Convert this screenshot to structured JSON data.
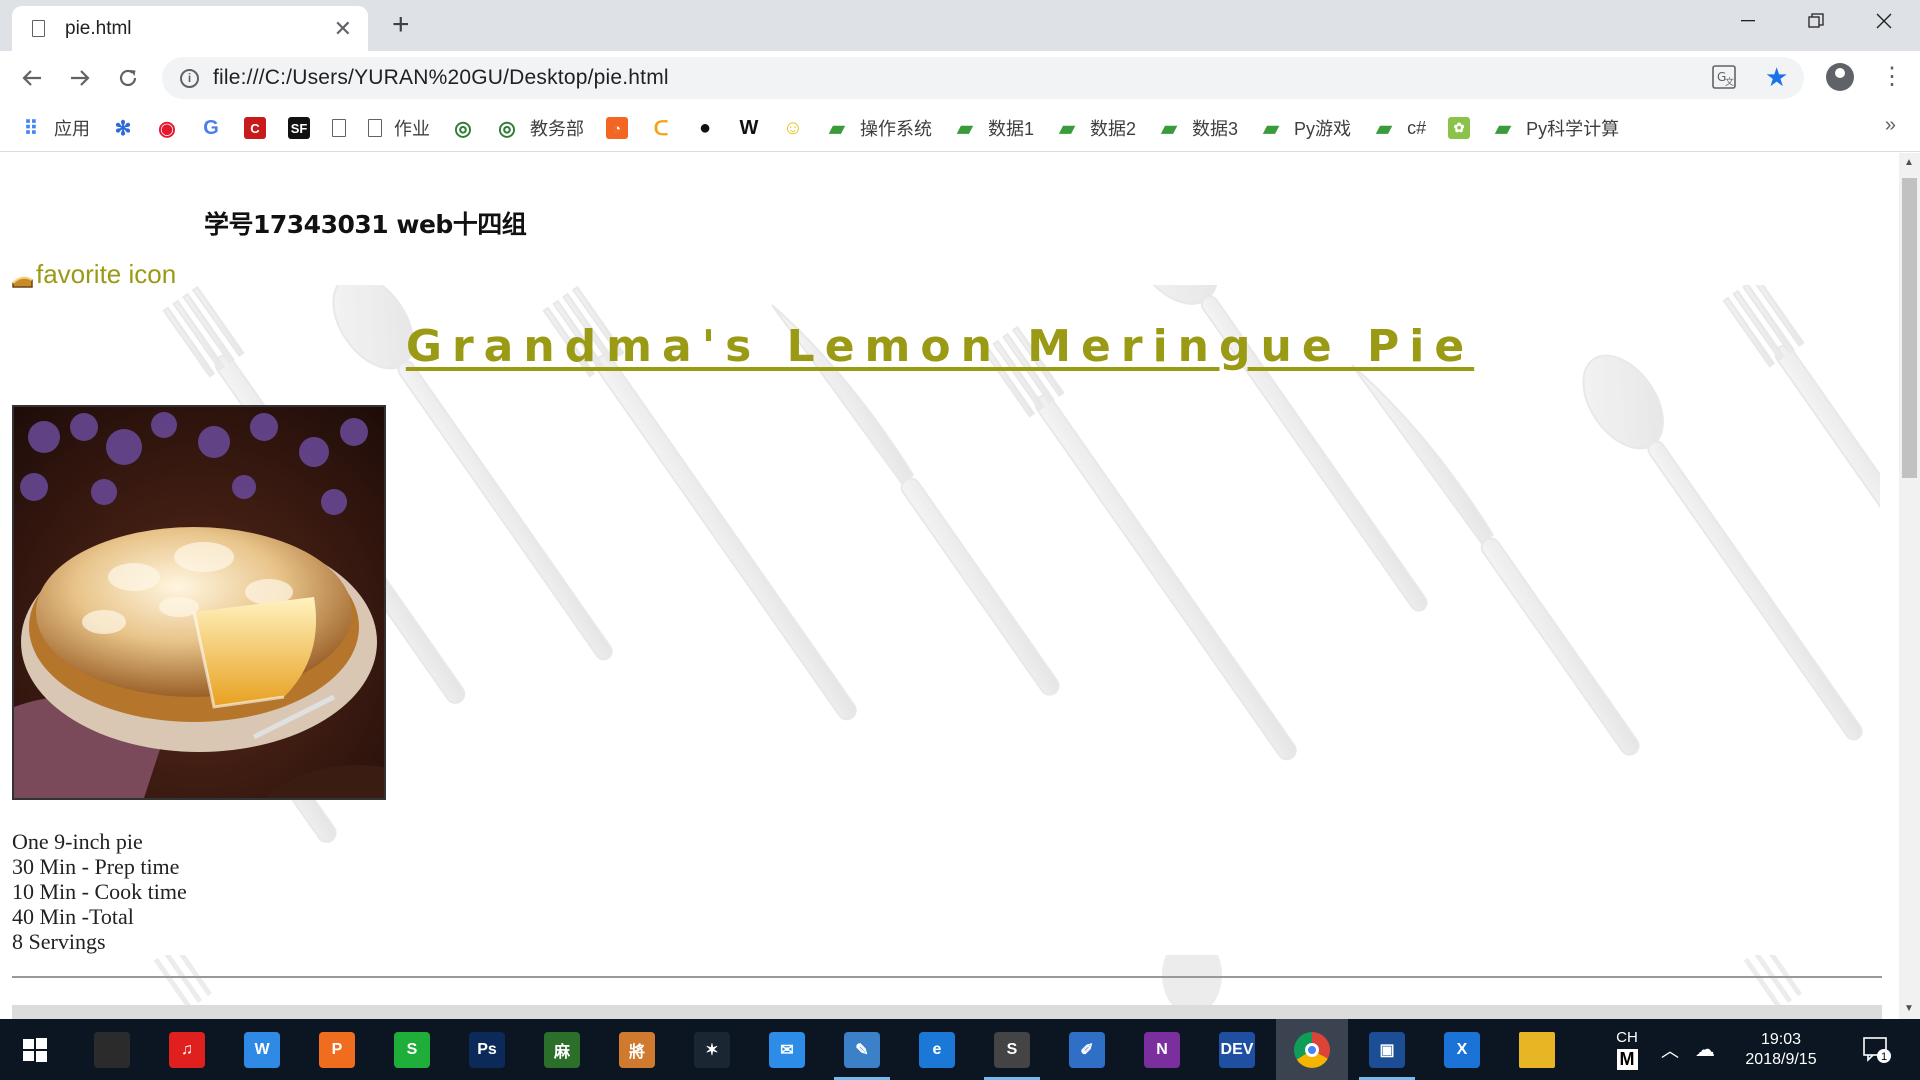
{
  "browser": {
    "tab_title": "pie.html",
    "url": "file:///C:/Users/YURAN%20GU/Desktop/pie.html",
    "bookmarks": [
      {
        "label": "应用",
        "icon": "apps-grid-icon",
        "color": "#4285f4"
      },
      {
        "label": "",
        "icon": "baidu-paw-icon",
        "color": "#2f6bd6"
      },
      {
        "label": "",
        "icon": "weibo-icon",
        "color": "#e6162d"
      },
      {
        "label": "",
        "icon": "translate-icon",
        "color": "#4a7ee8"
      },
      {
        "label": "",
        "icon": "csdn-icon",
        "color": "#c81a1a"
      },
      {
        "label": "",
        "icon": "segmentfault-icon",
        "color": "#111111"
      },
      {
        "label": "",
        "icon": "page-icon",
        "color": "#5f6368"
      },
      {
        "label": "作业",
        "icon": "page-icon",
        "color": "#5f6368"
      },
      {
        "label": "",
        "icon": "university-seal-icon",
        "color": "#2e7d32"
      },
      {
        "label": "教务部",
        "icon": "university-seal-icon",
        "color": "#2e7d32"
      },
      {
        "label": "",
        "icon": "orange-app-icon",
        "color": "#f26522"
      },
      {
        "label": "",
        "icon": "leetcode-icon",
        "color": "#f89f1b"
      },
      {
        "label": "",
        "icon": "github-icon",
        "color": "#111111"
      },
      {
        "label": "",
        "icon": "wikipedia-icon",
        "color": "#111111"
      },
      {
        "label": "",
        "icon": "smiley-icon",
        "color": "#e8c21a"
      },
      {
        "label": "操作系统",
        "icon": "bookmark-folder-icon",
        "color": "#3a9b3a"
      },
      {
        "label": "数据1",
        "icon": "bookmark-folder-icon",
        "color": "#3a9b3a"
      },
      {
        "label": "数据2",
        "icon": "bookmark-folder-icon",
        "color": "#3a9b3a"
      },
      {
        "label": "数据3",
        "icon": "bookmark-folder-icon",
        "color": "#3a9b3a"
      },
      {
        "label": "Py游戏",
        "icon": "bookmark-folder-icon",
        "color": "#3a9b3a"
      },
      {
        "label": "c#",
        "icon": "bookmark-folder-icon",
        "color": "#3a9b3a"
      },
      {
        "label": "",
        "icon": "leaf-icon",
        "color": "#8bc34a"
      },
      {
        "label": "Py科学计算",
        "icon": "bookmark-folder-icon",
        "color": "#3a9b3a"
      }
    ],
    "more_bookmarks": "»"
  },
  "page": {
    "student_line": "学号17343031 web十四组",
    "favicon_alt": "favorite icon",
    "heading": "Grandma's Lemon Meringue Pie",
    "info_lines": [
      "One 9-inch pie",
      "30 Min - Prep time",
      "10 Min - Cook time",
      "40 Min -Total",
      "8 Servings"
    ],
    "accent_color": "#9a9a14"
  },
  "taskbar": {
    "apps": [
      {
        "name": "terminal-app",
        "glyph": "",
        "color": "#2b2b2b",
        "state": ""
      },
      {
        "name": "netease-music-app",
        "glyph": "♫",
        "color": "#e0201f",
        "state": ""
      },
      {
        "name": "wps-writer-app",
        "glyph": "W",
        "color": "#2f8ae5",
        "state": ""
      },
      {
        "name": "wps-presentation-app",
        "glyph": "P",
        "color": "#f06d1f",
        "state": ""
      },
      {
        "name": "wps-spreadsheet-app",
        "glyph": "S",
        "color": "#1fae3a",
        "state": ""
      },
      {
        "name": "photoshop-app",
        "glyph": "Ps",
        "color": "#0b2a5a",
        "state": ""
      },
      {
        "name": "game-app",
        "glyph": "麻",
        "color": "#2b6f2b",
        "state": ""
      },
      {
        "name": "chess-app",
        "glyph": "將",
        "color": "#d07a30",
        "state": ""
      },
      {
        "name": "starcraft-app",
        "glyph": "✶",
        "color": "#1b2633",
        "state": ""
      },
      {
        "name": "mail-app",
        "glyph": "✉",
        "color": "#2d8ce8",
        "state": ""
      },
      {
        "name": "paint-app",
        "glyph": "✎",
        "color": "#3c80c8",
        "state": "running"
      },
      {
        "name": "edge-app",
        "glyph": "e",
        "color": "#1c78d6",
        "state": ""
      },
      {
        "name": "sublime-app",
        "glyph": "S",
        "color": "#444444",
        "state": "running"
      },
      {
        "name": "notes-app",
        "glyph": "✐",
        "color": "#2f6fc5",
        "state": ""
      },
      {
        "name": "onenote-app",
        "glyph": "N",
        "color": "#7b2f9e",
        "state": ""
      },
      {
        "name": "devcpp-app",
        "glyph": "DEV",
        "color": "#1f4fa0",
        "state": ""
      },
      {
        "name": "chrome-app",
        "glyph": "",
        "color": "#db4437",
        "state": "active"
      },
      {
        "name": "photos-app",
        "glyph": "▣",
        "color": "#1b4e94",
        "state": "running"
      },
      {
        "name": "xshell-app",
        "glyph": "X",
        "color": "#1b73d8",
        "state": ""
      },
      {
        "name": "file-explorer-app",
        "glyph": "",
        "color": "#e8b624",
        "state": ""
      }
    ],
    "ime_lang": "CH",
    "ime_mode": "M",
    "time": "19:03",
    "date": "2018/9/15",
    "notification_count": "1"
  }
}
